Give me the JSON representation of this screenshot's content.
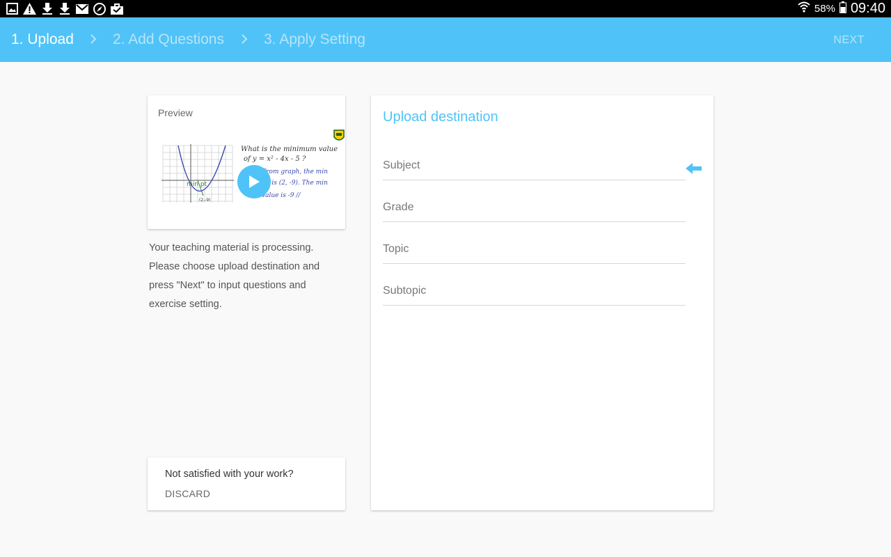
{
  "status_bar": {
    "left_icons": [
      "image-icon",
      "warning-icon",
      "download-icon",
      "download-icon",
      "mail-icon",
      "compass-icon",
      "briefcase-icon"
    ],
    "battery": "58%",
    "time": "09:40"
  },
  "stepper": {
    "steps": [
      {
        "label": "1. Upload",
        "active": true
      },
      {
        "label": "2. Add Questions",
        "active": false
      },
      {
        "label": "3. Apply Setting",
        "active": false
      }
    ],
    "next_label": "NEXT"
  },
  "preview": {
    "label": "Preview",
    "thumbnail_text": {
      "line1": "What is the minimum value",
      "line2": "of y = x² - 4x - 5 ?",
      "line3": "From graph, the min",
      "line4": "point is (2, -9). The min",
      "line5": "value is -9 //",
      "graph_label": "min pt",
      "point_label": "(2,-9)"
    }
  },
  "info": {
    "line1": "Your teaching material is processing.",
    "line2": "Please choose upload destination and",
    "line3": "press \"Next\" to input questions and",
    "line4": "exercise setting."
  },
  "discard": {
    "question": "Not satisfied with your work?",
    "button": "DISCARD"
  },
  "destination": {
    "title": "Upload destination",
    "fields": [
      "Subject",
      "Grade",
      "Topic",
      "Subtopic"
    ]
  },
  "colors": {
    "accent": "#4fc3f7",
    "inactive_step": "#b8e4fb"
  }
}
